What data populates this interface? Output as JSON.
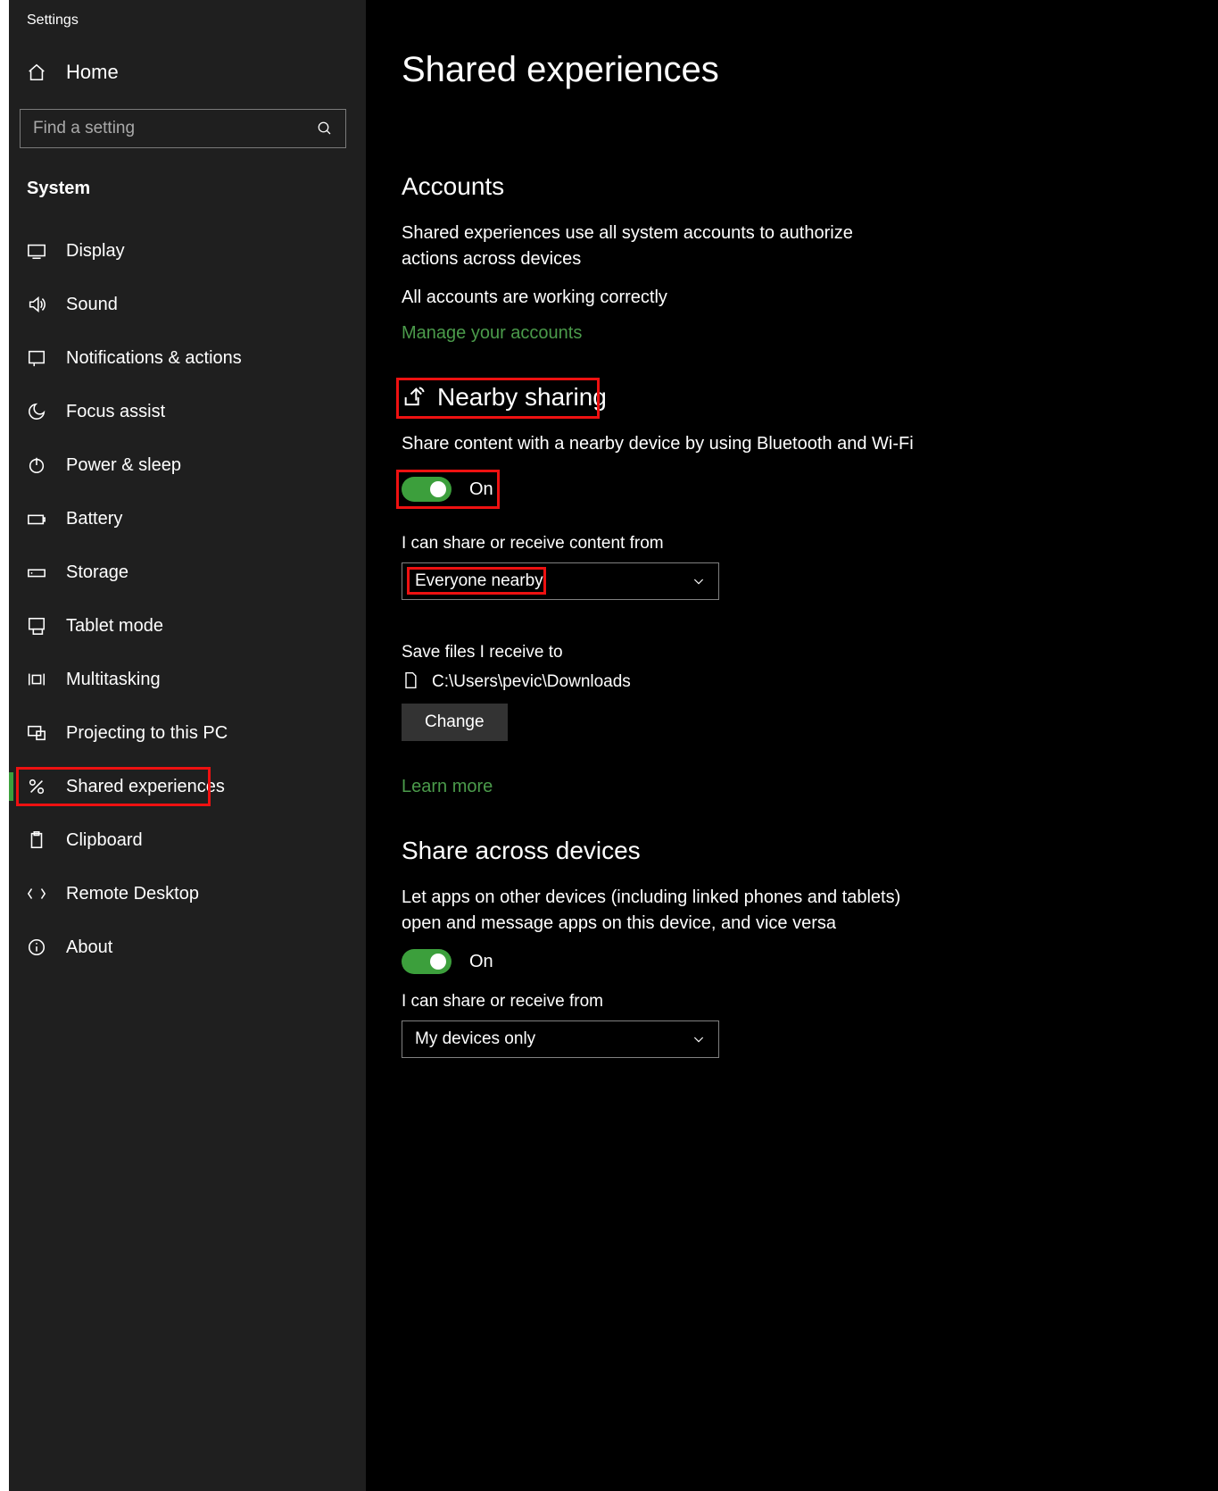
{
  "window_title": "Settings",
  "sidebar": {
    "home_label": "Home",
    "search_placeholder": "Find a setting",
    "category_label": "System",
    "items": [
      {
        "label": "Display",
        "icon": "display-icon"
      },
      {
        "label": "Sound",
        "icon": "sound-icon"
      },
      {
        "label": "Notifications & actions",
        "icon": "notifications-icon"
      },
      {
        "label": "Focus assist",
        "icon": "focus-assist-icon"
      },
      {
        "label": "Power & sleep",
        "icon": "power-icon"
      },
      {
        "label": "Battery",
        "icon": "battery-icon"
      },
      {
        "label": "Storage",
        "icon": "storage-icon"
      },
      {
        "label": "Tablet mode",
        "icon": "tablet-icon"
      },
      {
        "label": "Multitasking",
        "icon": "multitasking-icon"
      },
      {
        "label": "Projecting to this PC",
        "icon": "projecting-icon"
      },
      {
        "label": "Shared experiences",
        "icon": "shared-exp-icon",
        "active": true
      },
      {
        "label": "Clipboard",
        "icon": "clipboard-icon"
      },
      {
        "label": "Remote Desktop",
        "icon": "remote-desktop-icon"
      },
      {
        "label": "About",
        "icon": "about-icon"
      }
    ]
  },
  "main": {
    "page_title": "Shared experiences",
    "accounts": {
      "title": "Accounts",
      "desc": "Shared experiences use all system accounts to authorize actions across devices",
      "status": "All accounts are working correctly",
      "manage_link": "Manage your accounts"
    },
    "nearby": {
      "title": "Nearby sharing",
      "desc": "Share content with a nearby device by using Bluetooth and Wi-Fi",
      "toggle_label": "On",
      "receive_label": "I can share or receive content from",
      "receive_value": "Everyone nearby",
      "save_label": "Save files I receive to",
      "save_path": "C:\\Users\\pevic\\Downloads",
      "change_button": "Change",
      "learn_link": "Learn more"
    },
    "across": {
      "title": "Share across devices",
      "desc": "Let apps on other devices (including linked phones and tablets) open and message apps on this device, and vice versa",
      "toggle_label": "On",
      "receive_label": "I can share or receive from",
      "receive_value": "My devices only"
    }
  }
}
